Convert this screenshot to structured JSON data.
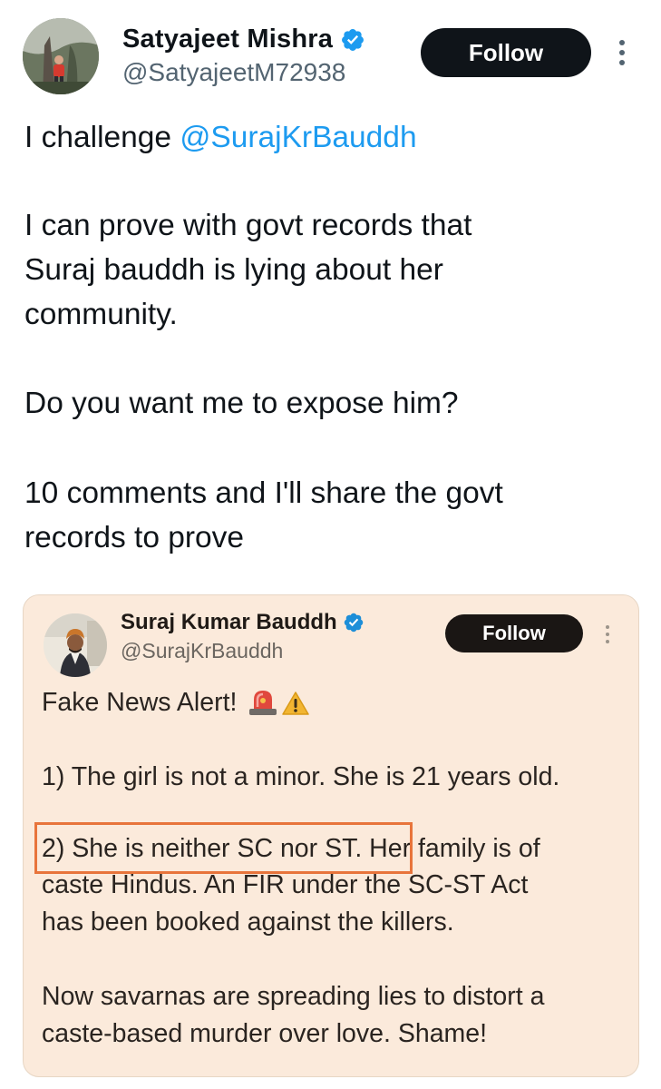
{
  "tweet": {
    "author": {
      "name": "Satyajeet Mishra",
      "handle": "@SatyajeetM72938",
      "verified": true
    },
    "follow_label": "Follow",
    "more_icon": "more-options-icon",
    "text": {
      "line1_prefix": "I challenge ",
      "line1_mention": "@SurajKrBauddh",
      "line2": "I can prove with govt records that",
      "line3": "Suraj bauddh is lying about her",
      "line4": "community.",
      "line5": "Do you want me to expose him?",
      "line6": "10 comments and I'll share the govt",
      "line7": "records to prove"
    }
  },
  "quoted_tweet": {
    "author": {
      "name": "Suraj Kumar Bauddh",
      "handle": "@SurajKrBauddh",
      "verified": true
    },
    "follow_label": "Follow",
    "text": {
      "line1": "Fake News Alert!",
      "line1_emojis": [
        "siren-icon",
        "warning-icon"
      ],
      "line2": "1) The girl is not a minor. She is 21 years old.",
      "line3": "2) She is neither SC nor ST. Her family is of",
      "line4": "caste Hindus. An FIR under the SC-ST Act",
      "line5": "has been booked against the killers.",
      "line6": "Now savarnas are spreading lies to distort a",
      "line7": "caste-based murder over love. Shame!"
    },
    "highlight_color": "#e8743b"
  },
  "colors": {
    "link": "#1d9bf0",
    "verified": "#1d9bf0",
    "quote_background": "#fbeadb",
    "follow_button": "#0f1419"
  }
}
